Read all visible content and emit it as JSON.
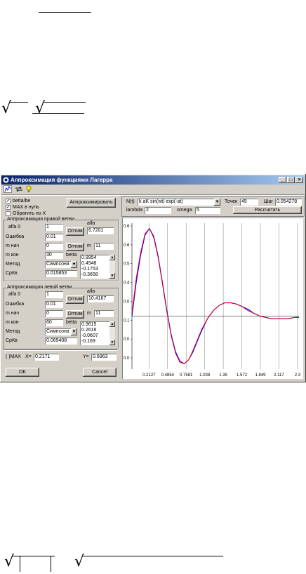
{
  "window": {
    "title": "Аппроксимация функциями Лагерра"
  },
  "left_panel": {
    "check_betta": {
      "label": "betta/be",
      "checked": true
    },
    "check_max_zero": {
      "label": "MAX в нуль",
      "checked": true
    },
    "check_reverse": {
      "label": "Обратить по X",
      "checked": false
    },
    "approx_button": "Аппроксимировать",
    "right_group": {
      "title": "Аппроксимация правой ветви",
      "alfa0_label": "alfa 0",
      "alfa0_value": "1",
      "alfa_label": "alfa",
      "error_label": "Ошибка",
      "error_value": "0.01",
      "optim_button": "Оптим",
      "alfa_value": "6.7201",
      "mstart_label": "m нач",
      "mstart_value": "0",
      "optim2_button": "Оптим",
      "m_label": "m",
      "m_value": "11",
      "mend_label": "m кон",
      "mend_value": "30",
      "betta_label": "betta",
      "method_label": "Метод",
      "method_value": "Симпсона",
      "srkv_label": "СрКв",
      "srkv_value": "0.015853",
      "betta_values": [
        "0.9954",
        "0.4948",
        "-0.1753",
        "-0.3658"
      ]
    },
    "left_group": {
      "title": "Аппроксимация левой ветви",
      "alfa0_label": "alfa 0",
      "alfa0_value": "1",
      "alfa_label": "alfa",
      "error_label": "Ошибка",
      "error_value": "0.01",
      "optim_button": "Оптим",
      "alfa_value": "10.4167",
      "mstart_label": "m нач",
      "mstart_value": "0",
      "optim2_button": "Оптим",
      "m_label": "m",
      "m_value": "11",
      "mend_label": "m кон",
      "mend_value": "60",
      "betta_label": "betta",
      "method_label": "Метод",
      "method_value": "Симпсона",
      "srkv_label": "СрКв",
      "srkv_value": "0.069408",
      "betta_values": [
        "0.9615",
        "0.2616",
        "-0.0607",
        "-0.169"
      ]
    },
    "max_label": "( )MAX",
    "x_label": "X=",
    "x_value": "0.2171",
    "y_label": "Y=",
    "y_value": "0.6963",
    "ok_button": "OK",
    "cancel_button": "Cancel"
  },
  "top_controls": {
    "nt_label": "N(t)",
    "formula": "k aK sin(wt) exp(-at)",
    "points_label": "Точек",
    "points_value": "45",
    "step_label": "Шаг",
    "step_value": "0.054278",
    "lambda_label": "lambda",
    "lambda_value": "2",
    "omega_label": "omega",
    "omega_value": "5",
    "compute_button": "Рассчитать"
  },
  "colors": {
    "titlebar_start": "#0a246a",
    "titlebar_end": "#a6caf0",
    "curve_original": "#0000ff",
    "curve_approx": "#ff0000",
    "grid": "#808080"
  },
  "chart_data": {
    "type": "line",
    "series": [
      {
        "color": "#0000ff",
        "x": [
          0.0,
          0.06,
          0.12,
          0.18,
          0.24,
          0.3,
          0.36,
          0.42,
          0.48,
          0.54,
          0.6,
          0.66,
          0.72,
          0.78,
          0.84,
          0.9,
          0.96,
          1.04,
          1.12,
          1.2,
          1.28,
          1.36,
          1.44,
          1.52,
          1.6,
          1.68,
          1.76,
          1.84,
          1.92,
          2.0,
          2.08,
          2.16,
          2.24,
          2.3
        ],
        "y": [
          0.0,
          0.26,
          0.46,
          0.61,
          0.66,
          0.6,
          0.45,
          0.25,
          0.04,
          -0.14,
          -0.27,
          -0.34,
          -0.36,
          -0.33,
          -0.27,
          -0.19,
          -0.11,
          -0.02,
          0.04,
          0.08,
          0.1,
          0.1,
          0.09,
          0.07,
          0.05,
          0.02,
          0.0,
          -0.01,
          -0.02,
          -0.02,
          -0.02,
          -0.02,
          -0.01,
          -0.01
        ]
      },
      {
        "color": "#ff0000",
        "x": [
          0.0,
          0.06,
          0.12,
          0.18,
          0.24,
          0.3,
          0.36,
          0.42,
          0.48,
          0.54,
          0.6,
          0.66,
          0.72,
          0.78,
          0.84,
          0.9,
          0.96,
          1.04,
          1.12,
          1.2,
          1.28,
          1.36,
          1.44,
          1.52,
          1.6,
          1.68,
          1.76,
          1.84,
          1.92,
          2.0,
          2.08,
          2.16,
          2.24,
          2.3
        ],
        "y": [
          0.02,
          0.29,
          0.48,
          0.62,
          0.66,
          0.59,
          0.44,
          0.24,
          0.03,
          -0.15,
          -0.28,
          -0.35,
          -0.36,
          -0.33,
          -0.26,
          -0.18,
          -0.1,
          -0.02,
          0.04,
          0.08,
          0.1,
          0.1,
          0.09,
          0.07,
          0.04,
          0.02,
          0.0,
          -0.01,
          -0.02,
          -0.02,
          -0.02,
          -0.02,
          -0.01,
          -0.01
        ]
      }
    ],
    "x_ticks": [
      "0.2127",
      "0.4854",
      "0.7581",
      "1.038",
      "1.35",
      "1.572",
      "1.849",
      "2.117",
      "2.3"
    ],
    "y_ticks": [
      "0.6",
      "0.6",
      "0.5",
      "0.4",
      "0.0",
      "0.1",
      "0.0",
      "0.0"
    ],
    "xlim": [
      0,
      2.3
    ],
    "ylim": [
      -0.4,
      0.7
    ],
    "grid": true
  }
}
